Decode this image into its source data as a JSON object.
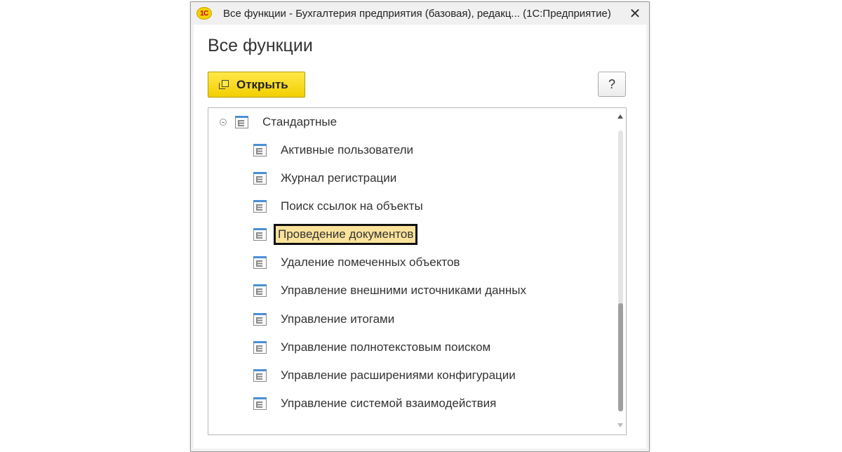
{
  "window": {
    "logo_text": "1С",
    "title": "Все функции - Бухгалтерия предприятия (базовая), редакц...   (1С:Предприятие)",
    "close_symbol": "✕"
  },
  "page": {
    "title": "Все функции"
  },
  "toolbar": {
    "open_label": "Открыть",
    "help_label": "?"
  },
  "tree": {
    "group_label": "Стандартные",
    "items": [
      {
        "label": "Активные пользователи"
      },
      {
        "label": "Журнал регистрации"
      },
      {
        "label": "Поиск ссылок на объекты"
      },
      {
        "label": "Проведение документов",
        "selected": true
      },
      {
        "label": "Удаление помеченных объектов"
      },
      {
        "label": "Управление внешними источниками данных"
      },
      {
        "label": "Управление итогами"
      },
      {
        "label": "Управление полнотекстовым поиском"
      },
      {
        "label": "Управление расширениями конфигурации"
      },
      {
        "label": "Управление системой взаимодействия"
      }
    ]
  },
  "colors": {
    "accent_button": "#f2cf00",
    "selection_fill": "#fbe39c",
    "icon_blue": "#4a8fd6"
  }
}
